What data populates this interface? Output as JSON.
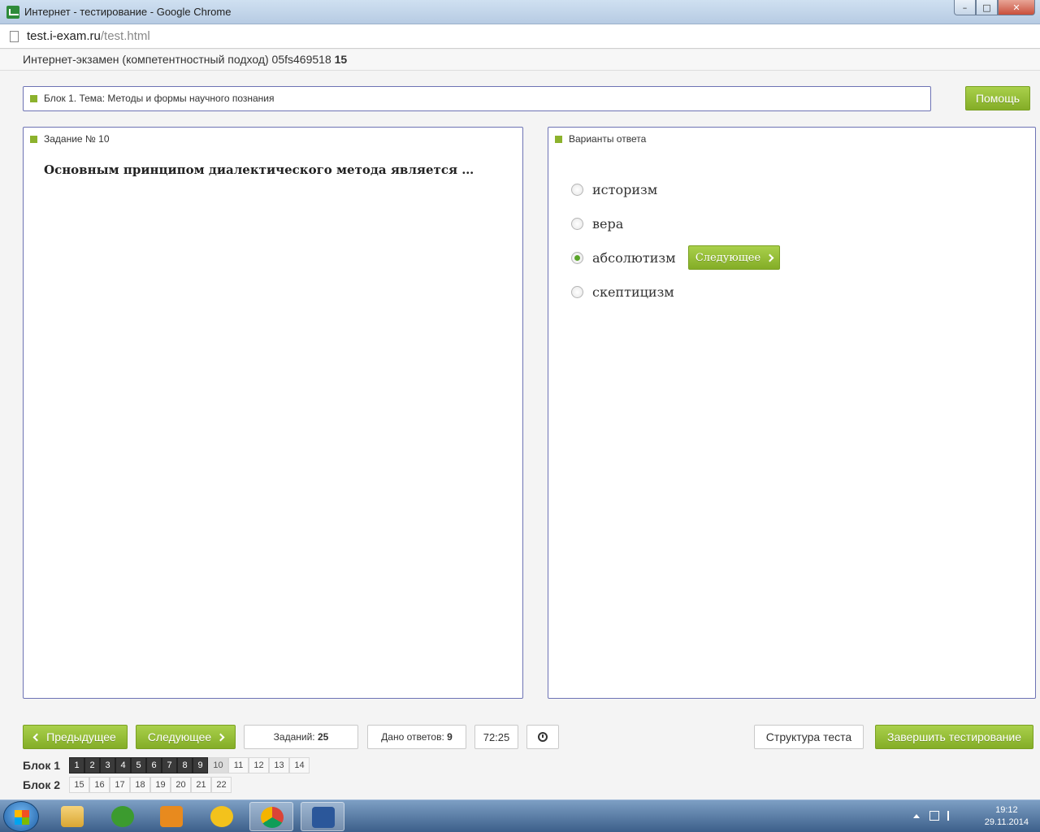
{
  "window": {
    "title": "Интернет - тестирование - Google Chrome",
    "controls": {
      "minimize": "–",
      "maximize": "□",
      "close": "✕"
    }
  },
  "address": {
    "domain": "test.i-exam.ru",
    "path": "/test.html"
  },
  "header": {
    "title": "Интернет-экзамен (компетентностный подход) 05fs469518",
    "number": "15"
  },
  "topic": {
    "label": "Блок 1. Тема: Методы и формы научного познания"
  },
  "help_button": "Помощь",
  "task": {
    "label": "Задание № 10",
    "question": "Основным принципом диалектического метода является …"
  },
  "answers": {
    "label": "Варианты ответа",
    "options": [
      {
        "text": "историзм",
        "selected": false
      },
      {
        "text": "вера",
        "selected": false
      },
      {
        "text": "абсолютизм",
        "selected": true
      },
      {
        "text": "скептицизм",
        "selected": false
      }
    ],
    "next_inline": "Следующее"
  },
  "nav": {
    "prev": "Предыдущее",
    "next": "Следующее",
    "tasks_label": "Заданий:",
    "tasks_count": "25",
    "answered_label": "Дано ответов:",
    "answered_count": "9",
    "timer": "72:25",
    "structure": "Структура теста",
    "finish": "Завершить тестирование"
  },
  "blocks": [
    {
      "name": "Блок 1",
      "items": [
        "1",
        "2",
        "3",
        "4",
        "5",
        "6",
        "7",
        "8",
        "9",
        "10",
        "11",
        "12",
        "13",
        "14"
      ],
      "done": 9,
      "current": "10"
    },
    {
      "name": "Блок 2",
      "items": [
        "15",
        "16",
        "17",
        "18",
        "19",
        "20",
        "21",
        "22"
      ],
      "done": 0,
      "current": ""
    }
  ],
  "tray": {
    "time": "19:12",
    "date": "29.11.2014"
  },
  "colors": {
    "accent": "#8cb22d",
    "panel_border": "#6d73b4"
  }
}
